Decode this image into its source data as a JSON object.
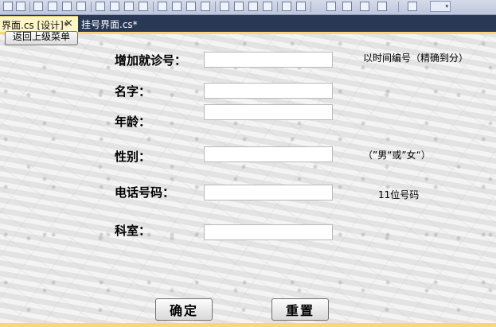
{
  "tabs": {
    "active_label": "界面.cs [设计]*",
    "close_glyph": "×",
    "inactive_label": "挂号界面.cs*"
  },
  "toolbar": {
    "icons": [
      "align-left-icon",
      "align-center-icon",
      "align-right-icon",
      "align-top-icon",
      "align-middle-icon",
      "align-bottom-icon",
      "same-width-icon",
      "same-height-icon",
      "same-size-icon",
      "size-to-grid-icon",
      "hspacing-equal-icon",
      "hspacing-increase-icon",
      "hspacing-decrease-icon",
      "hspacing-remove-icon",
      "vspacing-equal-icon",
      "vspacing-increase-icon",
      "vspacing-decrease-icon",
      "vspacing-remove-icon",
      "center-horizontal-icon",
      "center-vertical-icon",
      "bring-front-icon",
      "send-back-icon",
      "tab-order-icon"
    ],
    "dropdown_glyph": "▾"
  },
  "form": {
    "back_button": "返回上级菜单",
    "fields": [
      {
        "label": "增加就诊号：",
        "value": "",
        "hint": "以时间编号（精确到分）"
      },
      {
        "label": "名字：",
        "value": "",
        "hint": ""
      },
      {
        "label": "年龄：",
        "value": "",
        "hint": ""
      },
      {
        "label": "性别：",
        "value": "",
        "hint": "（”男“或”女“）"
      },
      {
        "label": "电话号码：",
        "value": "",
        "hint": "11位号码"
      },
      {
        "label": "科室：",
        "value": "",
        "hint": ""
      }
    ],
    "confirm_button": "确定",
    "reset_button": "重置"
  },
  "colors": {
    "tabstrip_bg": "#293955",
    "active_tab_bg": "#fff6c8",
    "designer_border": "#f5d87e"
  }
}
